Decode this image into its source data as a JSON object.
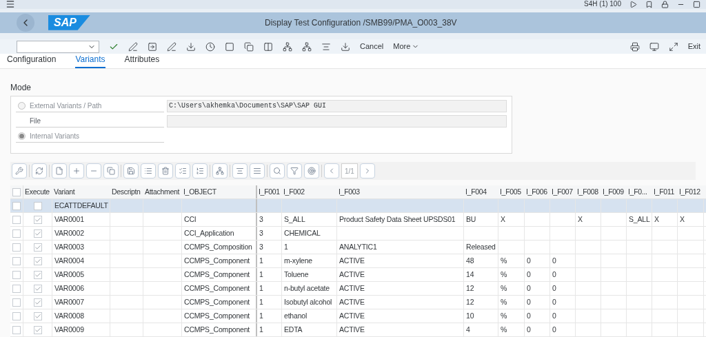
{
  "system_bar": {
    "system": "S4H (1) 100"
  },
  "header": {
    "title": "Display Test Configuration /SMB99/PMA_O003_38V",
    "logo": "SAP"
  },
  "toolbar": {
    "buttons": [
      "Cancel",
      "More"
    ],
    "exit": "Exit"
  },
  "tabs": [
    {
      "label": "Configuration",
      "selected": false
    },
    {
      "label": "Variants",
      "selected": true
    },
    {
      "label": "Attributes",
      "selected": false
    }
  ],
  "mode": {
    "title": "Mode",
    "options": [
      {
        "label": "External Variants / Path",
        "selected": false,
        "value": "C:\\Users\\akhemka\\Documents\\SAP\\SAP GUI"
      },
      {
        "label": "Internal Variants",
        "selected": true
      }
    ],
    "file_label": "File"
  },
  "pager": "1/1",
  "table": {
    "select_all": false,
    "execute_header": "Execute",
    "columns": [
      "Variant",
      "Descriptn",
      "Attachment",
      "I_OBJECT",
      "I_F001",
      "I_F002",
      "I_F003",
      "I_F004",
      "I_F005",
      "I_F006",
      "I_F007",
      "I_F008",
      "I_F009",
      "I_F0...",
      "I_F011",
      "I_F012"
    ],
    "rows": [
      {
        "selected": true,
        "checked": false,
        "execute": false,
        "cells": [
          "ECATTDEFAULT",
          "",
          "",
          "",
          "",
          "",
          "",
          "",
          "",
          "",
          "",
          "",
          "",
          "",
          "",
          ""
        ]
      },
      {
        "selected": false,
        "checked": false,
        "execute": true,
        "cells": [
          "VAR0001",
          "",
          "",
          "CCI",
          "3",
          "S_ALL",
          "Product Safety Data Sheet UPSDS01",
          "BU",
          "X",
          "",
          "",
          "X",
          "",
          "S_ALL",
          "X",
          "X"
        ]
      },
      {
        "selected": false,
        "checked": false,
        "execute": true,
        "cells": [
          "VAR0002",
          "",
          "",
          "CCI_Application",
          "3",
          "CHEMICAL",
          "",
          "",
          "",
          "",
          "",
          "",
          "",
          "",
          "",
          ""
        ]
      },
      {
        "selected": false,
        "checked": false,
        "execute": true,
        "cells": [
          "VAR0003",
          "",
          "",
          "CCMPS_Composition",
          "3",
          "1",
          "ANALYTIC1",
          "Released",
          "",
          "",
          "",
          "",
          "",
          "",
          "",
          ""
        ]
      },
      {
        "selected": false,
        "checked": false,
        "execute": true,
        "cells": [
          "VAR0004",
          "",
          "",
          "CCMPS_Component",
          "1",
          "m-xylene",
          "ACTIVE",
          "48",
          "%",
          "0",
          "0",
          "",
          "",
          "",
          "",
          ""
        ]
      },
      {
        "selected": false,
        "checked": false,
        "execute": true,
        "cells": [
          "VAR0005",
          "",
          "",
          "CCMPS_Component",
          "1",
          "Toluene",
          "ACTIVE",
          "14",
          "%",
          "0",
          "0",
          "",
          "",
          "",
          "",
          ""
        ]
      },
      {
        "selected": false,
        "checked": false,
        "execute": true,
        "cells": [
          "VAR0006",
          "",
          "",
          "CCMPS_Component",
          "1",
          "n-butyl acetate",
          "ACTIVE",
          "12",
          "%",
          "0",
          "0",
          "",
          "",
          "",
          "",
          ""
        ]
      },
      {
        "selected": false,
        "checked": false,
        "execute": true,
        "cells": [
          "VAR0007",
          "",
          "",
          "CCMPS_Component",
          "1",
          "Isobutyl alcohol",
          "ACTIVE",
          "12",
          "%",
          "0",
          "0",
          "",
          "",
          "",
          "",
          ""
        ]
      },
      {
        "selected": false,
        "checked": false,
        "execute": true,
        "cells": [
          "VAR0008",
          "",
          "",
          "CCMPS_Component",
          "1",
          "ethanol",
          "ACTIVE",
          "10",
          "%",
          "0",
          "0",
          "",
          "",
          "",
          "",
          ""
        ]
      },
      {
        "selected": false,
        "checked": false,
        "execute": true,
        "cells": [
          "VAR0009",
          "",
          "",
          "CCMPS_Component",
          "1",
          "EDTA",
          "ACTIVE",
          "4",
          "%",
          "0",
          "0",
          "",
          "",
          "",
          "",
          ""
        ]
      }
    ]
  }
}
